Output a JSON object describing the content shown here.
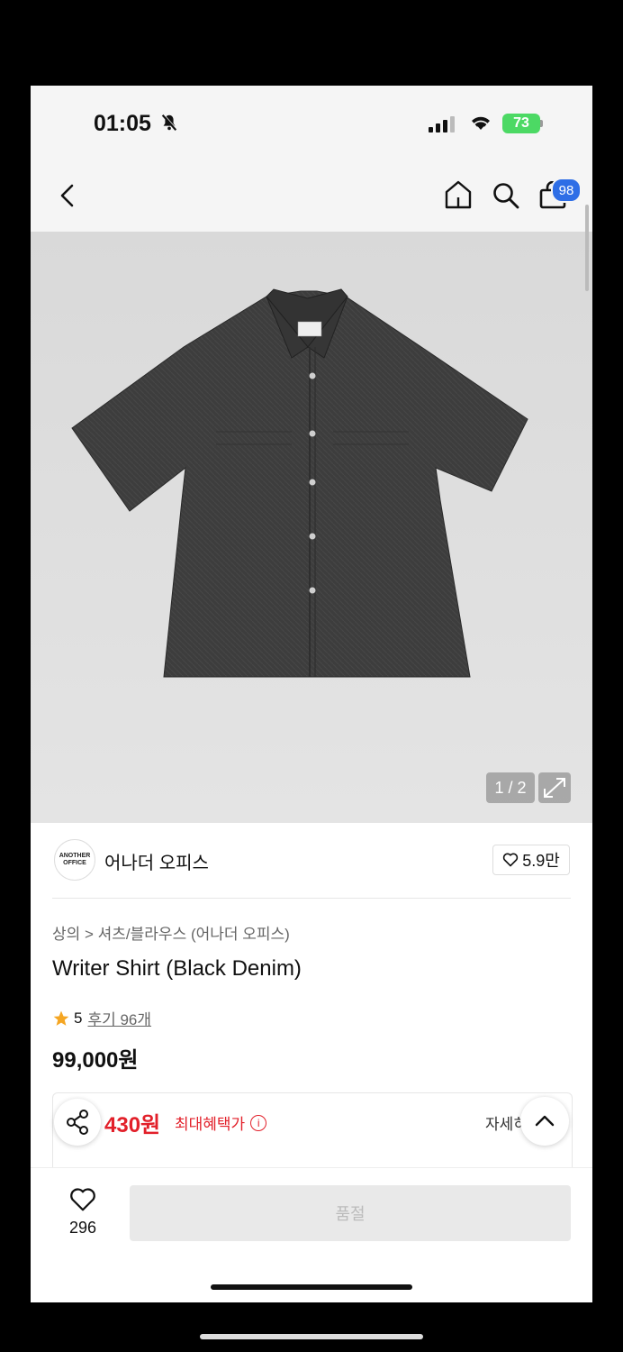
{
  "status_bar": {
    "time": "01:05",
    "battery": "73"
  },
  "header": {
    "cart_count": "98"
  },
  "gallery": {
    "counter": "1 / 2"
  },
  "brand": {
    "logo_text_1": "ANOTHER",
    "logo_text_2": "OFFICE",
    "name": "어나더 오피스",
    "likes": "5.9만"
  },
  "product": {
    "breadcrumb": "상의 > 셔츠/블라우스 (어나더 오피스)",
    "title": "Writer Shirt (Black Denim)",
    "rating": "5",
    "reviews": "후기 96개",
    "price": "99,000원"
  },
  "benefit": {
    "price": "430원",
    "label": "최대혜택가",
    "details": "자세히"
  },
  "bottom": {
    "wish_count": "296",
    "buy_label": "품절"
  },
  "colors": {
    "accent_red": "#e2202a",
    "badge_blue": "#2e6ee6",
    "star": "#f5a623"
  },
  "icons": [
    "bell-slash-icon",
    "signal-icon",
    "wifi-icon",
    "back-icon",
    "home-icon",
    "search-icon",
    "cart-icon",
    "expand-icon",
    "heart-icon",
    "star-icon",
    "share-icon",
    "info-icon",
    "chevron-up-icon"
  ]
}
